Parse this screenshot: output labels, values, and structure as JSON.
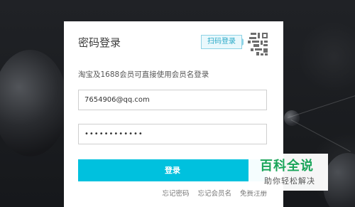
{
  "login": {
    "title": "密码登录",
    "qr_badge_label": "扫码登录",
    "subtitle": "淘宝及1688会员可直接使用会员名登录",
    "username_value": "7654906@qq.com",
    "password_value": "••••••••••••",
    "submit_label": "登录",
    "links": {
      "forgot_password": "忘记密码",
      "forgot_username": "忘记会员名",
      "register": "免费注册"
    }
  },
  "watermark": {
    "main": "百科全说",
    "sub": "助你轻松解决"
  },
  "colors": {
    "accent": "#00c1de",
    "background": "#1c1e22",
    "watermark_green": "#1aa55a"
  },
  "icons": {
    "qr": "qr-code-icon"
  }
}
